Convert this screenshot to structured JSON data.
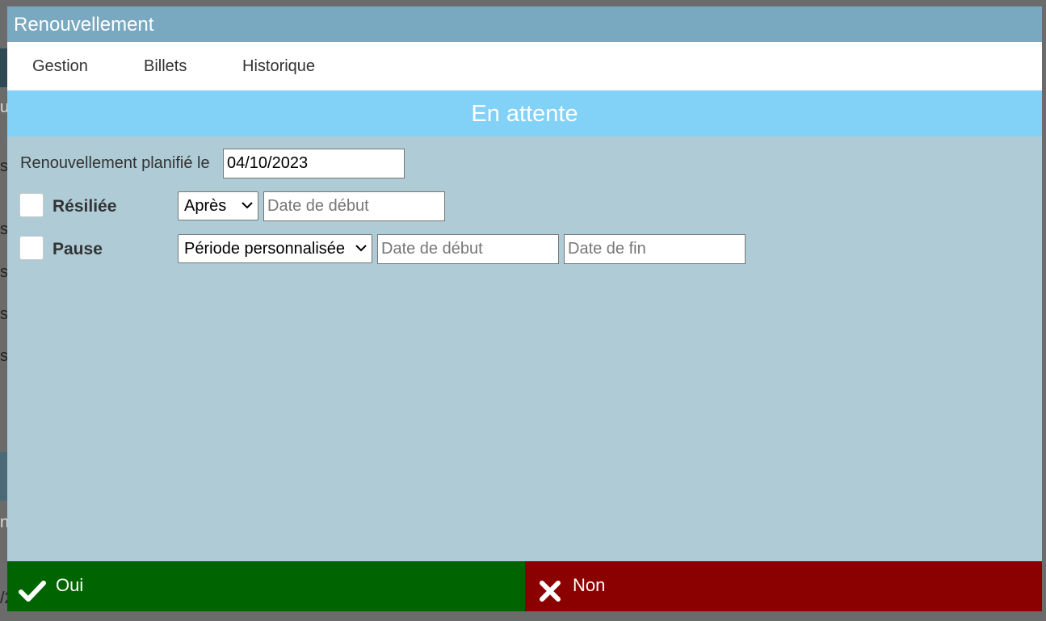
{
  "background": {
    "fragments": [
      "s/",
      "s/",
      "s/",
      "s/",
      "s/",
      "u",
      "n",
      "/2"
    ]
  },
  "modal": {
    "title": "Renouvellement",
    "tabs": [
      {
        "label": "Gestion"
      },
      {
        "label": "Billets"
      },
      {
        "label": "Historique"
      }
    ],
    "status": "En attente",
    "renewal": {
      "label": "Renouvellement planifié le",
      "date": "04/10/2023"
    },
    "resiliee": {
      "label": "Résiliée",
      "checked": false,
      "select_value": "Après",
      "start_placeholder": "Date de début"
    },
    "pause": {
      "label": "Pause",
      "checked": false,
      "select_value": "Période personnalisée",
      "start_placeholder": "Date de début",
      "end_placeholder": "Date de fin"
    },
    "buttons": {
      "yes_label": "Oui",
      "no_label": "Non"
    }
  },
  "colors": {
    "title_bar": "#79a9c0",
    "status_bar": "#82d1f7",
    "body": "#aecbd6",
    "yes": "#006400",
    "no": "#8b0000"
  },
  "icons": {
    "yes": "check-icon",
    "no": "close-icon"
  }
}
